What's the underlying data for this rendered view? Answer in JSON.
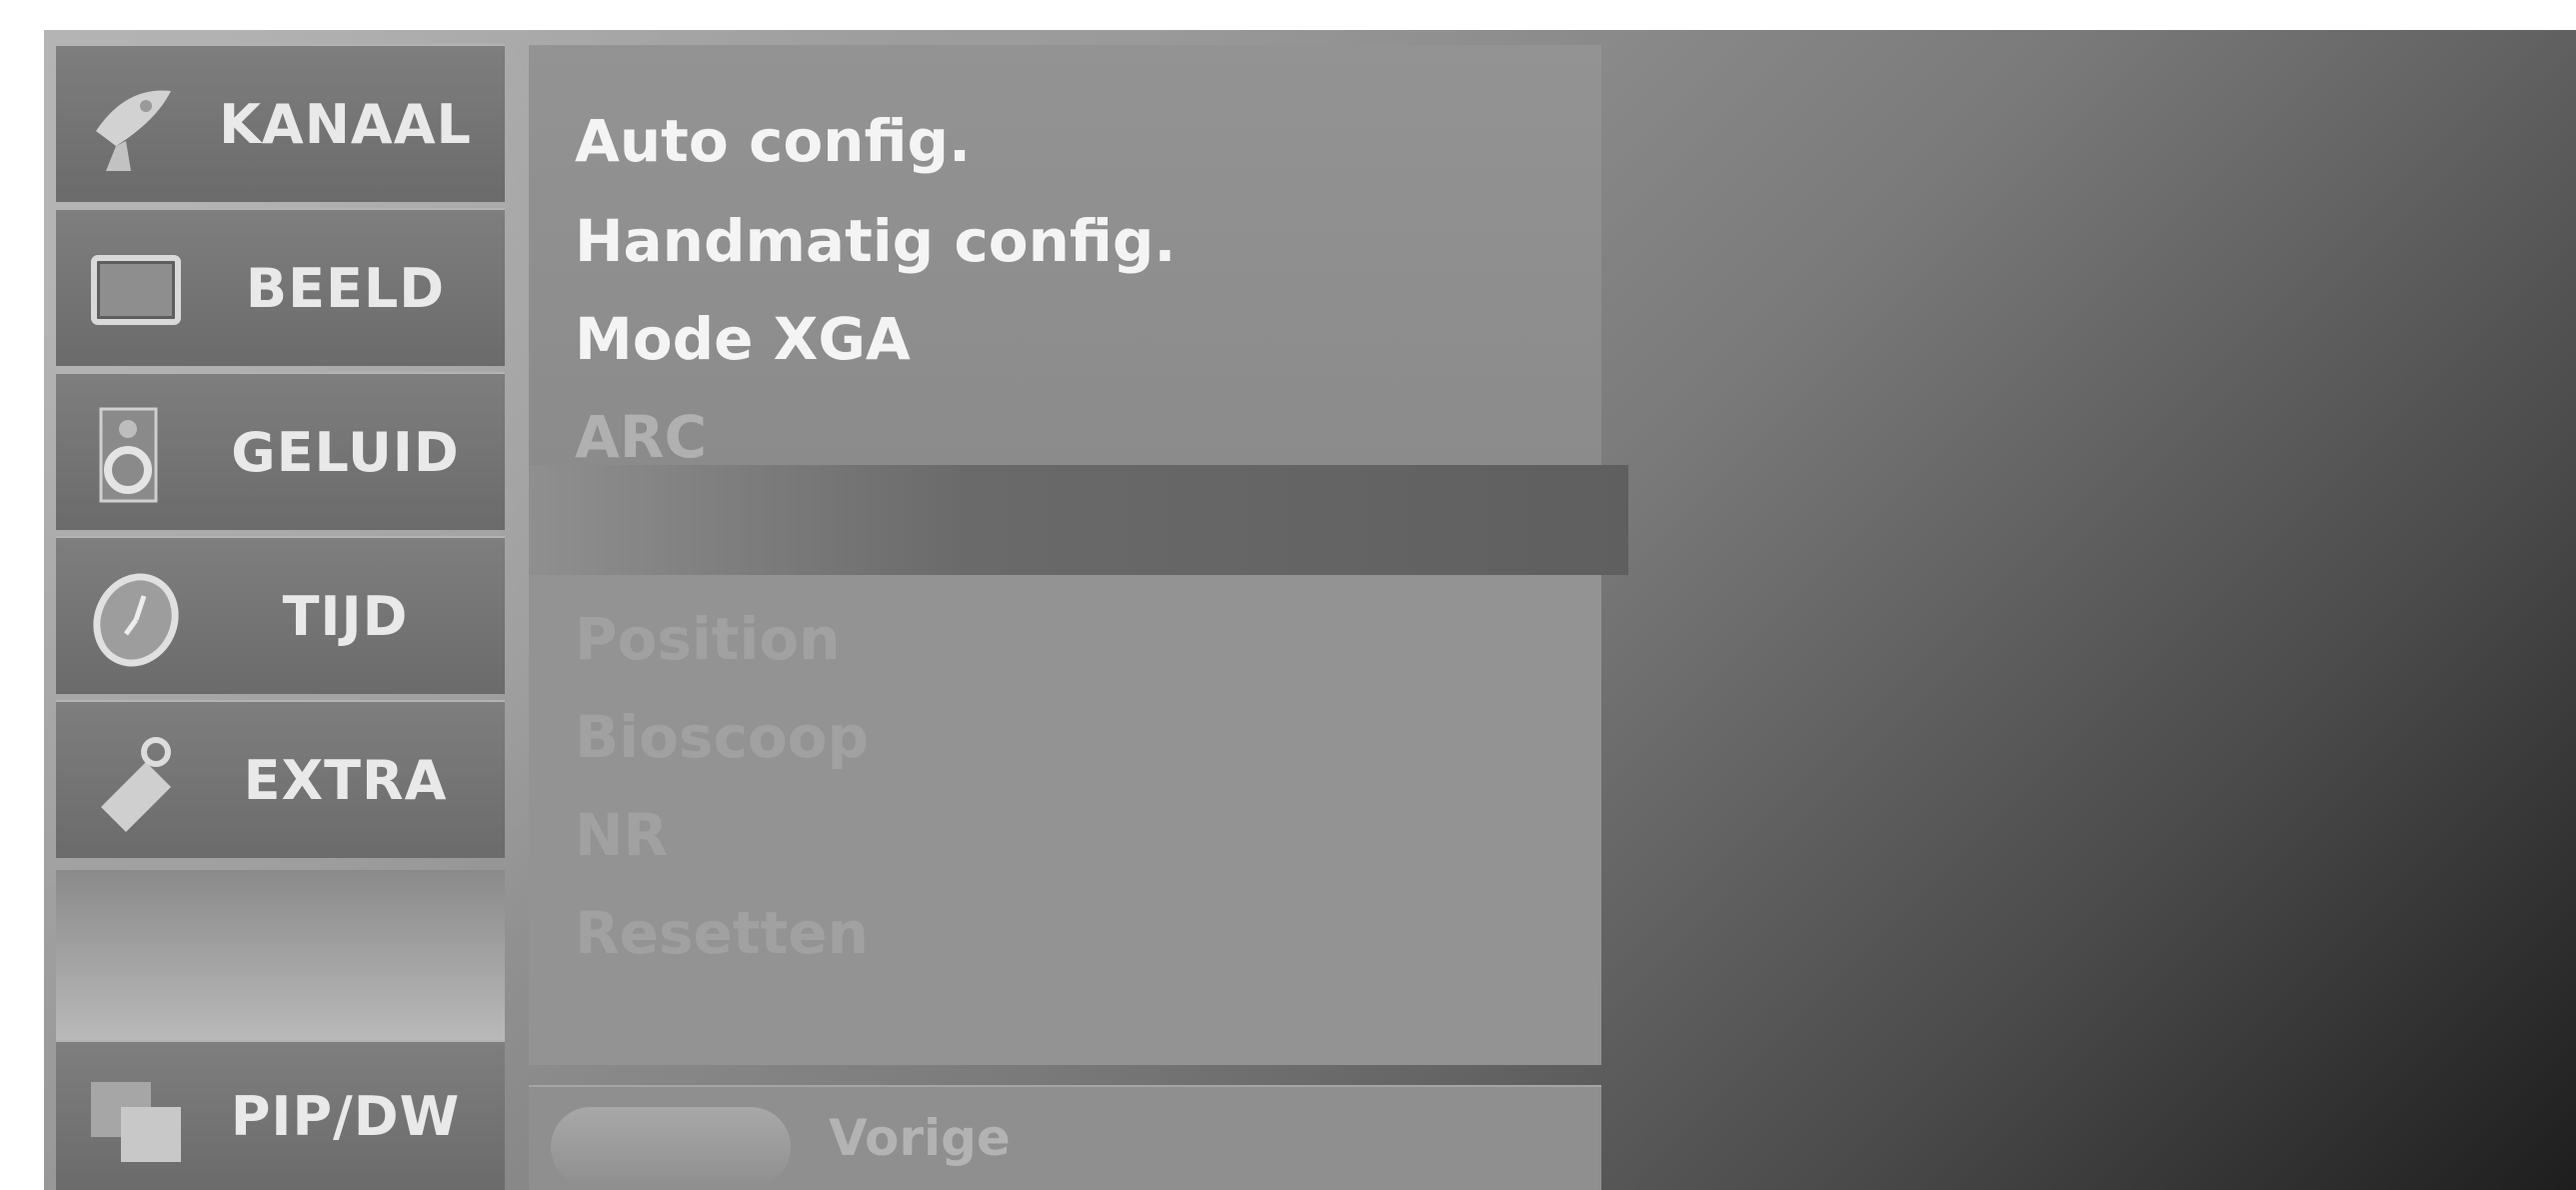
{
  "sidebar": {
    "items": [
      {
        "label": "KANAAL",
        "icon": "satellite-dish-icon"
      },
      {
        "label": "BEELD",
        "icon": "tv-screen-icon"
      },
      {
        "label": "GELUID",
        "icon": "speaker-icon"
      },
      {
        "label": "TIJD",
        "icon": "clock-icon"
      },
      {
        "label": "EXTRA",
        "icon": "tag-icon"
      }
    ],
    "bottom_item": {
      "label": "PIP/DW",
      "icon": "pip-windows-icon"
    }
  },
  "menu": {
    "items": [
      {
        "label": "Auto config.",
        "state": "enabled"
      },
      {
        "label": "Handmatig config.",
        "state": "highlighted"
      },
      {
        "label": "Mode XGA",
        "state": "enabled"
      },
      {
        "label": "ARC",
        "state": "dim"
      }
    ],
    "disabled_items": [
      {
        "label": "Position"
      },
      {
        "label": "Bioscoop"
      },
      {
        "label": "NR"
      },
      {
        "label": "Resetten"
      }
    ],
    "back_button_label": "Vorige"
  }
}
